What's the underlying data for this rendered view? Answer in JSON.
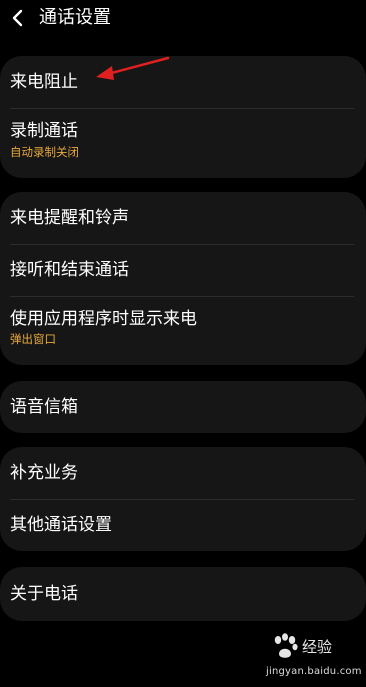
{
  "header": {
    "title": "通话设置"
  },
  "groups": [
    {
      "items": [
        {
          "label": "来电阻止",
          "sub": ""
        },
        {
          "label": "录制通话",
          "sub": "自动录制关闭"
        }
      ]
    },
    {
      "items": [
        {
          "label": "来电提醒和铃声",
          "sub": ""
        },
        {
          "label": "接听和结束通话",
          "sub": ""
        },
        {
          "label": "使用应用程序时显示来电",
          "sub": "弹出窗口"
        }
      ]
    },
    {
      "items": [
        {
          "label": "语音信箱",
          "sub": ""
        }
      ]
    },
    {
      "items": [
        {
          "label": "补充业务",
          "sub": ""
        },
        {
          "label": "其他通话设置",
          "sub": ""
        }
      ]
    },
    {
      "items": [
        {
          "label": "关于电话",
          "sub": ""
        }
      ]
    }
  ],
  "watermark": {
    "brand": "经验",
    "url": "jingyan.baidu.com"
  },
  "colors": {
    "background": "#000000",
    "card": "#161616",
    "subtext_accent": "#e8a93c",
    "annotation": "#e02020"
  }
}
